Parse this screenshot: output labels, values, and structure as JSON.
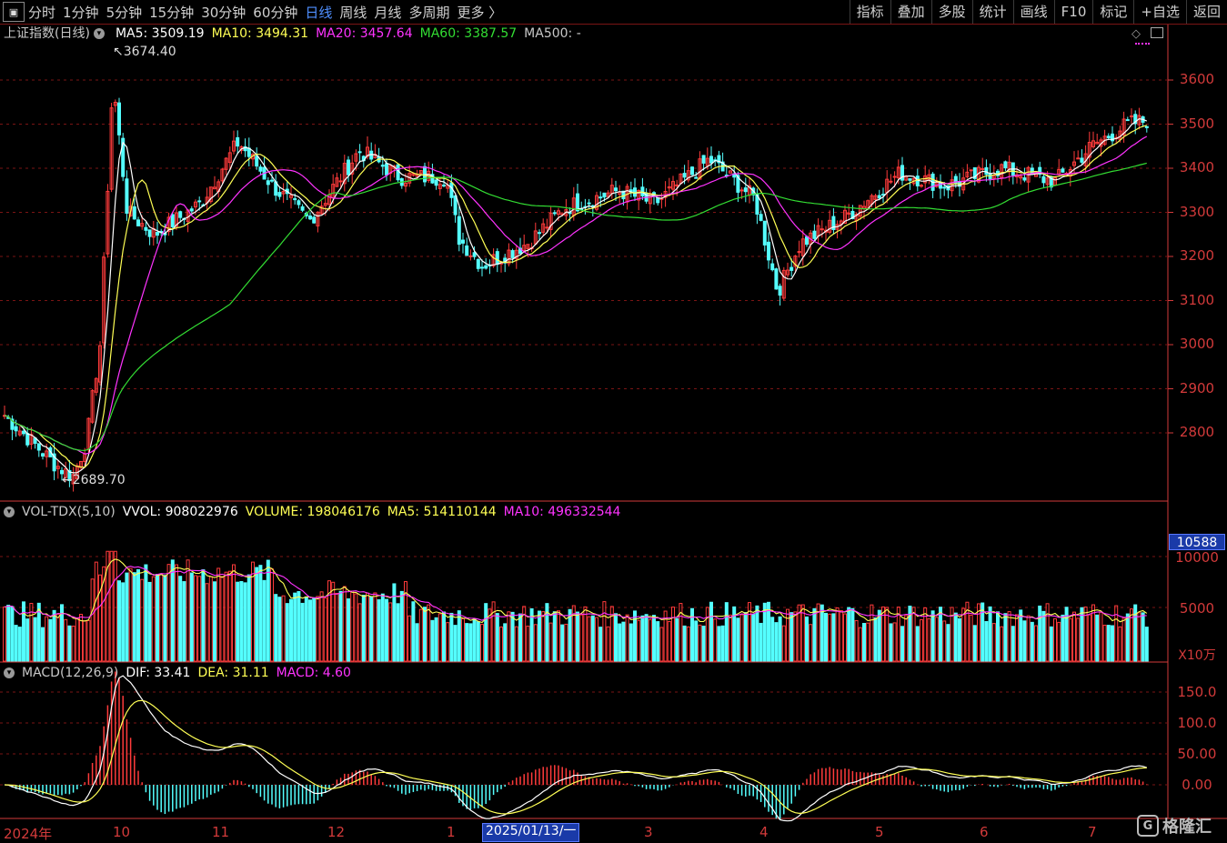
{
  "toolbar": {
    "periods": [
      "分时",
      "1分钟",
      "5分钟",
      "15分钟",
      "30分钟",
      "60分钟",
      "日线",
      "周线",
      "月线",
      "多周期",
      "更多 〉"
    ],
    "active_period": "日线",
    "tools": [
      "指标",
      "叠加",
      "多股",
      "统计",
      "画线",
      "F10",
      "标记",
      "+自选",
      "返回"
    ]
  },
  "main": {
    "title": "上证指数(日线)",
    "ma5_label": "MA5: 3509.19",
    "ma10_label": "MA10: 3494.31",
    "ma20_label": "MA20: 3457.64",
    "ma60_label": "MA60: 3387.57",
    "ma500_label": "MA500: -",
    "high_label": "3674.40",
    "low_label": "2689.70",
    "price_ticks": [
      "3600",
      "3500",
      "3400",
      "3300",
      "3200",
      "3100",
      "3000",
      "2900",
      "2800"
    ]
  },
  "volume": {
    "title": "VOL-TDX(5,10)",
    "vvol_label": "VVOL: 908022976",
    "volume_label": "VOLUME: 198046176",
    "ma5_label": "MA5: 514110144",
    "ma10_label": "MA10: 496332544",
    "badge": "10588",
    "ticks": [
      "10000",
      "5000"
    ],
    "unit": "X10万"
  },
  "macd": {
    "title": "MACD(12,26,9)",
    "dif_label": "DIF: 33.41",
    "dea_label": "DEA: 31.11",
    "macd_label": "MACD: 4.60",
    "ticks": [
      "150.0",
      "100.0",
      "50.00",
      "0.00"
    ]
  },
  "dates": {
    "labels": [
      "2024年",
      "10",
      "11",
      "12",
      "1",
      "3",
      "4",
      "5",
      "6",
      "7"
    ],
    "cursor": "2025/01/13/一"
  },
  "watermark": "格隆汇",
  "colors": {
    "up": "#ff3b3b",
    "down": "#54ffff",
    "ma5": "#ffffff",
    "ma10": "#ffff55",
    "ma20": "#ff33ff",
    "ma60": "#33dd33",
    "grid": "#7a1414",
    "axis": "#d23a3a"
  }
}
